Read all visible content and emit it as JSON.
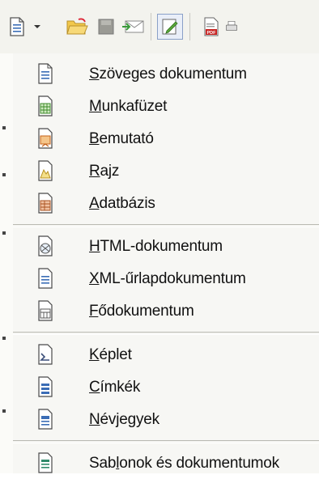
{
  "toolbar": {
    "buttons": [
      {
        "icon": "new-document-icon"
      },
      {
        "icon": "dropdown-arrow-icon"
      },
      {
        "icon": "open-folder-icon"
      },
      {
        "icon": "save-icon"
      },
      {
        "icon": "email-icon"
      },
      {
        "icon": "edit-document-icon"
      },
      {
        "icon": "export-pdf-icon"
      },
      {
        "icon": "print-icon"
      }
    ]
  },
  "menu": {
    "groups": [
      {
        "items": [
          {
            "mnemonic": "S",
            "rest": "zöveges dokumentum",
            "icon": "text-document-icon"
          },
          {
            "mnemonic": "M",
            "rest": "unkafüzet",
            "icon": "spreadsheet-icon"
          },
          {
            "mnemonic": "B",
            "rest": "emutató",
            "icon": "presentation-icon"
          },
          {
            "mnemonic": "R",
            "rest": "ajz",
            "icon": "drawing-icon"
          },
          {
            "mnemonic": "A",
            "rest": "datbázis",
            "icon": "database-icon"
          }
        ]
      },
      {
        "items": [
          {
            "mnemonic": "H",
            "rest": "TML-dokumentum",
            "icon": "html-document-icon"
          },
          {
            "mnemonic": "X",
            "rest": "ML-űrlapdokumentum",
            "icon": "xml-form-document-icon"
          },
          {
            "mnemonic": "F",
            "rest": "ődokumentum",
            "icon": "master-document-icon"
          }
        ]
      },
      {
        "items": [
          {
            "mnemonic": "K",
            "rest": "éplet",
            "icon": "formula-icon"
          },
          {
            "mnemonic": "C",
            "rest": "ímkék",
            "icon": "labels-icon"
          },
          {
            "mnemonic": "N",
            "rest": "évjegyek",
            "icon": "business-cards-icon"
          }
        ]
      },
      {
        "items": [
          {
            "pre": "Sab",
            "mnemonic": "l",
            "rest": "onok és dokumentumok",
            "icon": "templates-and-documents-icon"
          }
        ]
      }
    ]
  },
  "colors": {
    "menu_background": "#f7f7f4",
    "toolbar_background": "#f3f3ee",
    "separator": "#b9b9b2"
  }
}
